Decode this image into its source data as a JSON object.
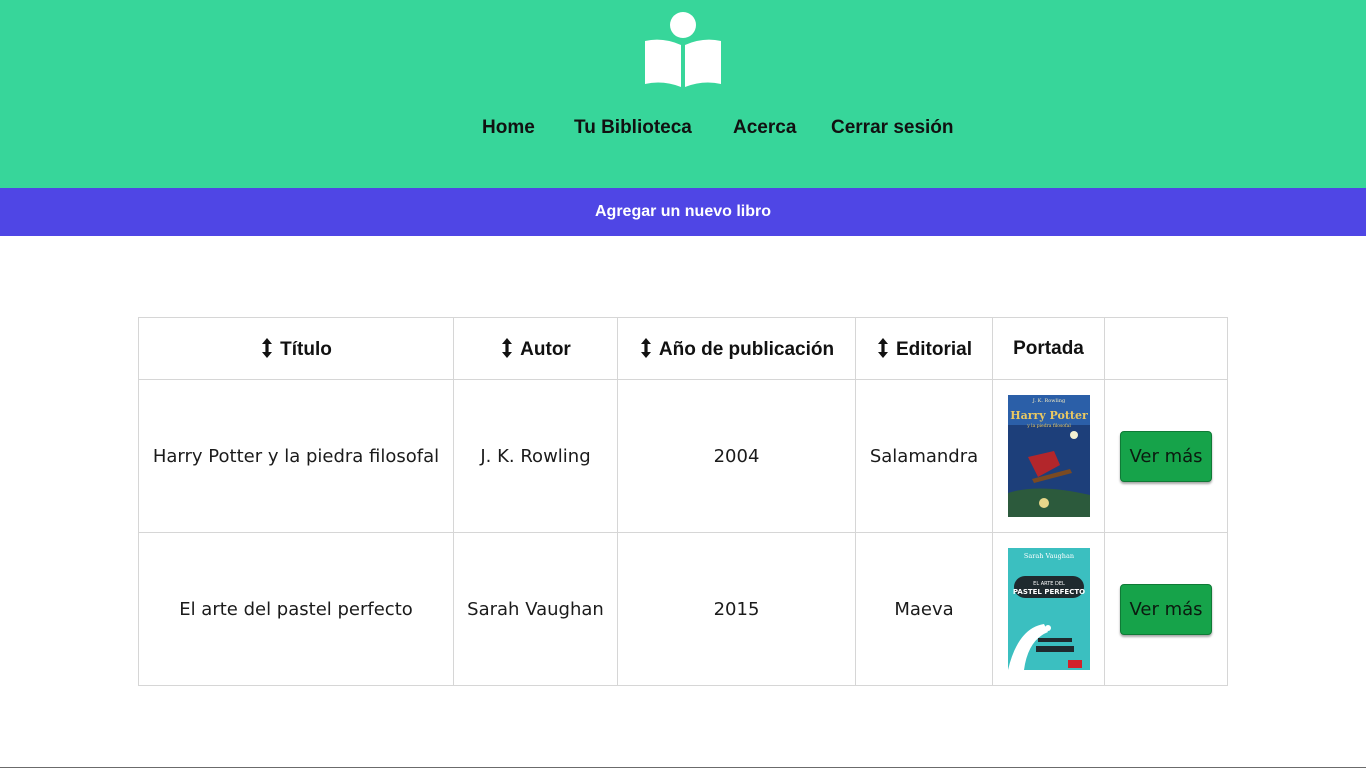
{
  "colors": {
    "header_bg": "#37d69a",
    "add_bar_bg": "#4f46e5",
    "button_bg": "#16a34a"
  },
  "header": {
    "logo_icon": "open-book-reader-icon",
    "nav": [
      "Home",
      "Tu Biblioteca",
      "Acerca",
      "Cerrar sesión"
    ]
  },
  "add_bar": {
    "label": "Agregar un nuevo libro"
  },
  "table": {
    "sort_icon": "up-down-arrow-icon",
    "headers": [
      "Título",
      "Autor",
      "Año de publicación",
      "Editorial",
      "Portada",
      ""
    ],
    "rows": [
      {
        "titulo": "Harry Potter y la piedra filosofal",
        "autor": "J. K. Rowling",
        "anio": "2004",
        "editorial": "Salamandra",
        "cover_top": "J. K. Rowling",
        "cover_title_1": "Harry Potter",
        "cover_title_2": "y la piedra filosofal",
        "button": "Ver más"
      },
      {
        "titulo": "El arte del pastel perfecto",
        "autor": "Sarah Vaughan",
        "anio": "2015",
        "editorial": "Maeva",
        "cover_top": "Sarah Vaughan",
        "cover_title_1": "EL ARTE DEL",
        "cover_title_2": "PASTEL PERFECTO",
        "button": "Ver más"
      }
    ]
  }
}
